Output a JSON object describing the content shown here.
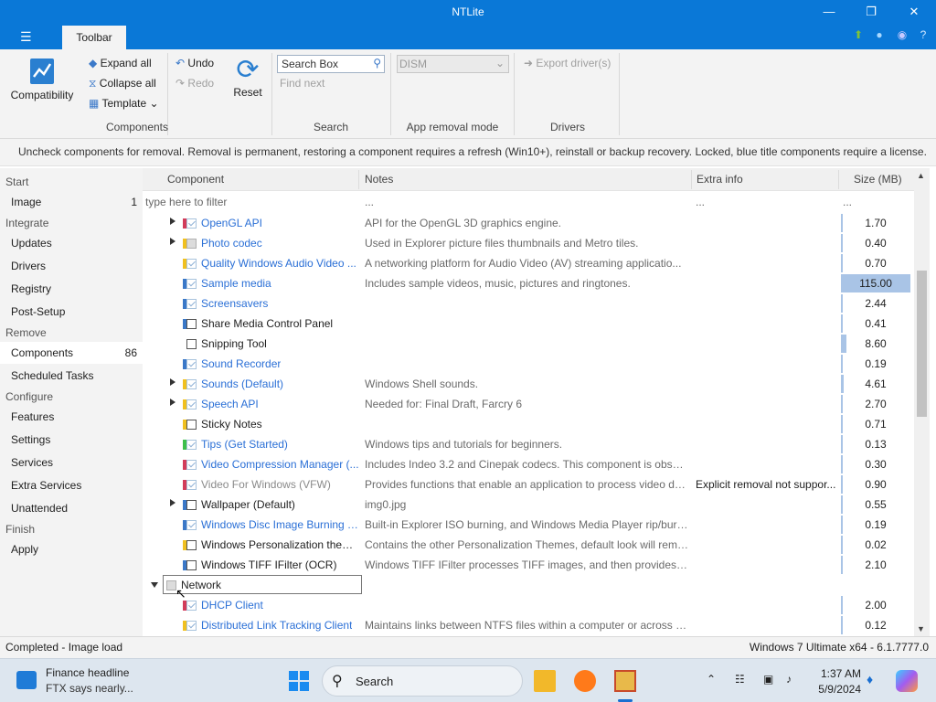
{
  "window": {
    "title": "NTLite",
    "menu_icon": "hamburger-icon"
  },
  "ribbon_tabs": [
    {
      "label": "Toolbar"
    }
  ],
  "ribbon": {
    "compatibility": "Compatibility",
    "expand_all": "Expand all",
    "collapse_all": "Collapse all",
    "template": "Template",
    "undo": "Undo",
    "redo": "Redo",
    "reset": "Reset",
    "search_placeholder": "Search Box",
    "find_next": "Find next",
    "dism_value": "DISM",
    "export_drivers": "Export driver(s)",
    "groups": [
      "Components",
      "Search",
      "App removal mode",
      "Drivers"
    ]
  },
  "notice": "Uncheck components for removal. Removal is permanent, restoring a component requires a refresh (Win10+), reinstall or backup recovery. Locked, blue title components require a license.",
  "sidebar": {
    "sections": [
      {
        "title": "Start",
        "items": [
          {
            "label": "Image",
            "count": "1"
          }
        ]
      },
      {
        "title": "Integrate",
        "items": [
          {
            "label": "Updates"
          },
          {
            "label": "Drivers"
          },
          {
            "label": "Registry"
          },
          {
            "label": "Post-Setup"
          }
        ]
      },
      {
        "title": "Remove",
        "items": [
          {
            "label": "Components",
            "count": "86",
            "active": true
          },
          {
            "label": "Scheduled Tasks"
          }
        ]
      },
      {
        "title": "Configure",
        "items": [
          {
            "label": "Features"
          },
          {
            "label": "Settings"
          },
          {
            "label": "Services"
          },
          {
            "label": "Extra Services"
          },
          {
            "label": "Unattended"
          }
        ]
      },
      {
        "title": "Finish",
        "items": [
          {
            "label": "Apply"
          }
        ]
      }
    ]
  },
  "grid": {
    "columns": [
      "Component",
      "Notes",
      "Extra info",
      "Size (MB)"
    ],
    "filter": {
      "component": "type here to filter",
      "notes": "...",
      "extra": "...",
      "size": "..."
    },
    "rows": [
      {
        "name": "OpenGL API",
        "notes": "API for the OpenGL 3D graphics engine.",
        "extra": "",
        "size": "1.70",
        "style": "blue",
        "check": "checked",
        "bar": "#d23c5a",
        "expand": true,
        "size_fraction": 0.015
      },
      {
        "name": "Photo codec",
        "notes": "Used in Explorer picture files thumbnails and Metro tiles.",
        "extra": "",
        "size": "0.40",
        "style": "blue",
        "check": "gray",
        "bar": "#f0c020",
        "expand": true,
        "size_fraction": 0.0
      },
      {
        "name": "Quality Windows Audio Video ...",
        "notes": "A networking platform for Audio Video (AV) streaming applicatio...",
        "extra": "",
        "size": "0.70",
        "style": "blue",
        "check": "checked",
        "bar": "#f0c020",
        "expand": false,
        "size_fraction": 0.0
      },
      {
        "name": "Sample media",
        "notes": "Includes sample videos, music, pictures and ringtones.",
        "extra": "",
        "size": "115.00",
        "style": "blue",
        "check": "checked",
        "bar": "#3a78c8",
        "expand": false,
        "size_fraction": 1.0
      },
      {
        "name": "Screensavers",
        "notes": "",
        "extra": "",
        "size": "2.44",
        "style": "blue",
        "check": "checked",
        "bar": "#3a78c8",
        "expand": false,
        "size_fraction": 0.02
      },
      {
        "name": "Share Media Control Panel",
        "notes": "",
        "extra": "",
        "size": "0.41",
        "style": "normal",
        "check": "empty",
        "bar": "#3a78c8",
        "expand": false,
        "size_fraction": 0.0
      },
      {
        "name": "Snipping Tool",
        "notes": "",
        "extra": "",
        "size": "8.60",
        "style": "normal",
        "check": "empty",
        "bar": "",
        "expand": false,
        "size_fraction": 0.075
      },
      {
        "name": "Sound Recorder",
        "notes": "",
        "extra": "",
        "size": "0.19",
        "style": "blue",
        "check": "checked",
        "bar": "#3a78c8",
        "expand": false,
        "size_fraction": 0.0
      },
      {
        "name": "Sounds (Default)",
        "notes": "Windows Shell sounds.",
        "extra": "",
        "size": "4.61",
        "style": "blue",
        "check": "checked",
        "bar": "#f0c020",
        "expand": true,
        "size_fraction": 0.04
      },
      {
        "name": "Speech API",
        "notes": "Needed for: Final Draft, Farcry 6",
        "extra": "",
        "size": "2.70",
        "style": "blue",
        "check": "checked",
        "bar": "#f0c020",
        "expand": true,
        "size_fraction": 0.023
      },
      {
        "name": "Sticky Notes",
        "notes": "",
        "extra": "",
        "size": "0.71",
        "style": "normal",
        "check": "empty",
        "bar": "#f0c020",
        "expand": false,
        "size_fraction": 0.0
      },
      {
        "name": "Tips (Get Started)",
        "notes": "Windows tips and tutorials for beginners.",
        "extra": "",
        "size": "0.13",
        "style": "blue",
        "check": "checked",
        "bar": "#3cbf4a",
        "expand": false,
        "size_fraction": 0.0
      },
      {
        "name": "Video Compression Manager (...",
        "notes": "Includes Indeo 3.2 and Cinepak codecs. This component is obsole...",
        "extra": "",
        "size": "0.30",
        "style": "blue",
        "check": "checked",
        "bar": "#d23c5a",
        "expand": false,
        "size_fraction": 0.0
      },
      {
        "name": "Video For Windows (VFW)",
        "notes": "Provides functions that enable an application to process video da...",
        "extra": "Explicit removal not suppor...",
        "size": "0.90",
        "style": "grey",
        "check": "checked",
        "bar": "#d23c5a",
        "expand": false,
        "size_fraction": 0.0
      },
      {
        "name": "Wallpaper (Default)",
        "notes": "img0.jpg",
        "extra": "",
        "size": "0.55",
        "style": "normal",
        "check": "empty",
        "bar": "#3a78c8",
        "expand": true,
        "size_fraction": 0.0
      },
      {
        "name": "Windows Disc Image Burning T...",
        "notes": "Built-in Explorer ISO burning, and Windows Media Player rip/burn...",
        "extra": "",
        "size": "0.19",
        "style": "blue",
        "check": "checked",
        "bar": "#3a78c8",
        "expand": false,
        "size_fraction": 0.0
      },
      {
        "name": "Windows Personalization themes",
        "notes": "Contains the other Personalization Themes, default look will rema...",
        "extra": "",
        "size": "0.02",
        "style": "normal",
        "check": "empty",
        "bar": "#f0c020",
        "expand": false,
        "size_fraction": 0.0
      },
      {
        "name": "Windows TIFF IFilter (OCR)",
        "notes": "Windows TIFF IFilter processes TIFF images, and then provides th...",
        "extra": "",
        "size": "2.10",
        "style": "normal",
        "check": "empty",
        "bar": "#3a78c8",
        "expand": false,
        "size_fraction": 0.018
      },
      {
        "name": "Network",
        "notes": "",
        "extra": "",
        "size": "",
        "style": "group",
        "check": "gray",
        "bar": "",
        "expand": false,
        "size_fraction": 0.0
      },
      {
        "name": "DHCP Client",
        "notes": "",
        "extra": "",
        "size": "2.00",
        "style": "blue",
        "check": "checked",
        "bar": "#d23c5a",
        "expand": false,
        "size_fraction": 0.017
      },
      {
        "name": "Distributed Link Tracking Client",
        "notes": "Maintains links between NTFS files within a computer or across c...",
        "extra": "",
        "size": "0.12",
        "style": "blue",
        "check": "checked",
        "bar": "#f0c020",
        "expand": false,
        "size_fraction": 0.0
      }
    ]
  },
  "status": {
    "left": "Completed - Image load",
    "right": "Windows 7 Ultimate x64 - 6.1.7777.0"
  },
  "taskbar": {
    "news_title": "Finance headline",
    "news_sub": "FTX says nearly...",
    "search_label": "Search",
    "time": "1:37 AM",
    "date": "5/9/2024"
  }
}
